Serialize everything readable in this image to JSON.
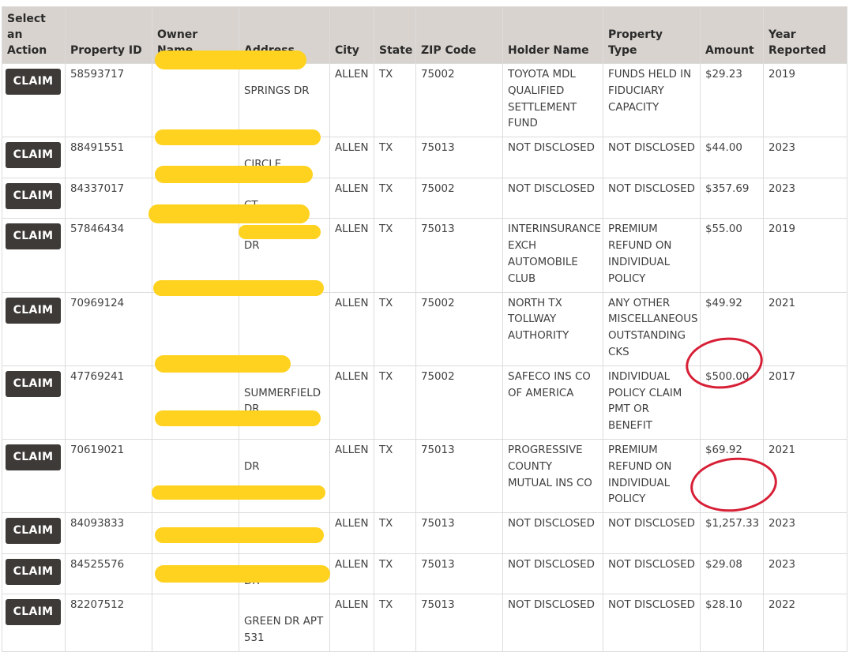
{
  "table": {
    "headers": [
      "Select an Action",
      "Property ID",
      "Owner Name",
      "Address",
      "City",
      "State",
      "ZIP Code",
      "Holder Name",
      "Property Type",
      "Amount",
      "Year Reported"
    ],
    "action_label": "CLAIM",
    "rows": [
      {
        "id": "58593717",
        "owner": "",
        "address": "SPRINGS DR",
        "city": "ALLEN",
        "state": "TX",
        "zip": "75002",
        "holder": "TOYOTA MDL QUALIFIED SETTLEMENT FUND",
        "type": "FUNDS HELD IN FIDUCIARY CAPACITY",
        "amount": "$29.23",
        "year": "2019"
      },
      {
        "id": "88491551",
        "owner": "",
        "address": "CIRCLE",
        "city": "ALLEN",
        "state": "TX",
        "zip": "75013",
        "holder": "NOT DISCLOSED",
        "type": "NOT DISCLOSED",
        "amount": "$44.00",
        "year": "2023"
      },
      {
        "id": "84337017",
        "owner": "",
        "address": "CT",
        "city": "ALLEN",
        "state": "TX",
        "zip": "75002",
        "holder": "NOT DISCLOSED",
        "type": "NOT DISCLOSED",
        "amount": "$357.69",
        "year": "2023"
      },
      {
        "id": "57846434",
        "owner": "",
        "address": "DR",
        "city": "ALLEN",
        "state": "TX",
        "zip": "75013",
        "holder": "INTERINSURANCE EXCH AUTOMOBILE CLUB",
        "type": "PREMIUM REFUND ON INDIVIDUAL POLICY",
        "amount": "$55.00",
        "year": "2019"
      },
      {
        "id": "70969124",
        "owner": "",
        "address": "",
        "city": "ALLEN",
        "state": "TX",
        "zip": "75002",
        "holder": "NORTH TX TOLLWAY AUTHORITY",
        "type": "ANY OTHER MISCELLANEOUS OUTSTANDING CKS",
        "amount": "$49.92",
        "year": "2021"
      },
      {
        "id": "47769241",
        "owner": "",
        "address": "SUMMERFIELD DR",
        "city": "ALLEN",
        "state": "TX",
        "zip": "75002",
        "holder": "SAFECO INS CO OF AMERICA",
        "type": "INDIVIDUAL POLICY CLAIM PMT OR BENEFIT",
        "amount": "$500.00",
        "year": "2017"
      },
      {
        "id": "70619021",
        "owner": "",
        "address": "DR",
        "city": "ALLEN",
        "state": "TX",
        "zip": "75013",
        "holder": "PROGRESSIVE COUNTY MUTUAL INS CO",
        "type": "PREMIUM REFUND ON INDIVIDUAL POLICY",
        "amount": "$69.92",
        "year": "2021"
      },
      {
        "id": "84093833",
        "owner": "",
        "address": "DR",
        "city": "ALLEN",
        "state": "TX",
        "zip": "75013",
        "holder": "NOT DISCLOSED",
        "type": "NOT DISCLOSED",
        "amount": "$1,257.33",
        "year": "2023"
      },
      {
        "id": "84525576",
        "owner": "",
        "address": "DR",
        "city": "ALLEN",
        "state": "TX",
        "zip": "75013",
        "holder": "NOT DISCLOSED",
        "type": "NOT DISCLOSED",
        "amount": "$29.08",
        "year": "2023"
      },
      {
        "id": "82207512",
        "owner": "",
        "address": "GREEN DR APT 531",
        "city": "ALLEN",
        "state": "TX",
        "zip": "75013",
        "holder": "NOT DISCLOSED",
        "type": "NOT DISCLOSED",
        "amount": "$28.10",
        "year": "2022"
      }
    ]
  },
  "colors": {
    "header_bg": "#d8d3ce",
    "button_bg": "#3d3a37",
    "redaction": "#ffd21f",
    "annotation_circle": "#d71f36"
  }
}
